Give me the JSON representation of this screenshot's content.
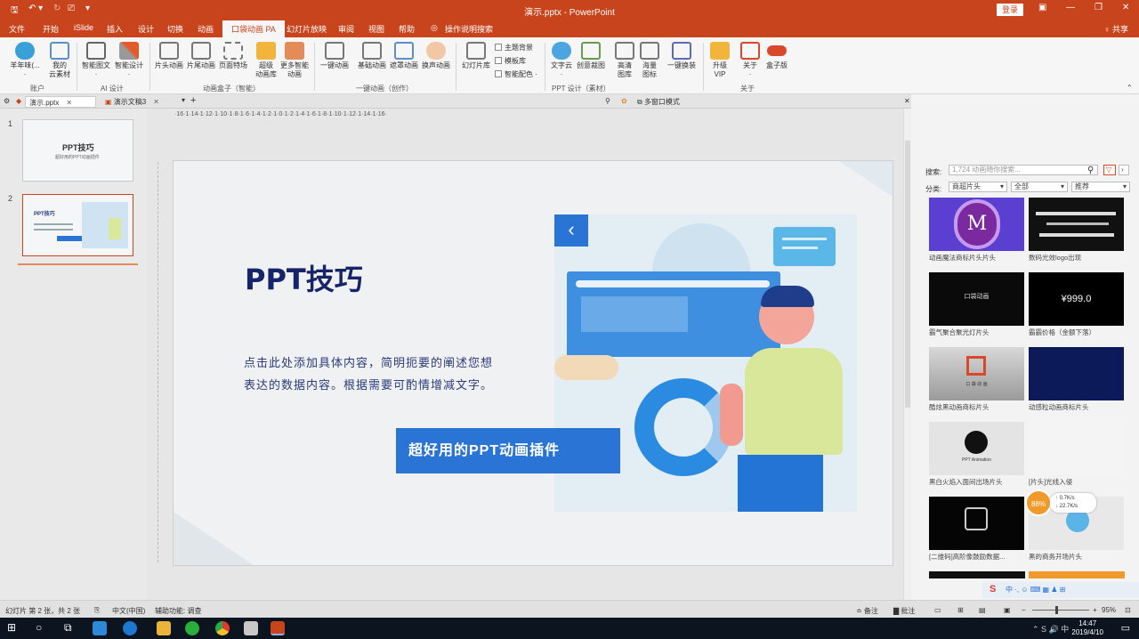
{
  "window": {
    "title": "演示.pptx  -  PowerPoint",
    "login": "登录",
    "share": "♀ 共享"
  },
  "menu": [
    "文件",
    "开始",
    "iSlide",
    "插入",
    "设计",
    "切换",
    "动画",
    "口袋动画 PA",
    "幻灯片放映",
    "审阅",
    "视图",
    "帮助",
    "操作说明搜索"
  ],
  "ribbon": {
    "buttons": [
      {
        "label": "羊年味(...",
        "sub": "·"
      },
      {
        "label": "我的",
        "sub": "云素材"
      },
      {
        "label": "智能图文",
        "sub": "·"
      },
      {
        "label": "智能设计",
        "sub": "·"
      },
      {
        "label": "片头动画",
        "sub": ""
      },
      {
        "label": "片尾动画",
        "sub": ""
      },
      {
        "label": "页面特场",
        "sub": ""
      },
      {
        "label": "超级",
        "sub": "动画库"
      },
      {
        "label": "更多智能",
        "sub": "动画"
      },
      {
        "label": "一键动画",
        "sub": ""
      },
      {
        "label": "基础动画",
        "sub": ""
      },
      {
        "label": "遮罩动画",
        "sub": ""
      },
      {
        "label": "换声动画",
        "sub": ""
      },
      {
        "label": "幻灯片库",
        "sub": ""
      },
      {
        "label": "文字云",
        "sub": "·"
      },
      {
        "label": "创意裁图",
        "sub": ""
      },
      {
        "label": "高清",
        "sub": "图库"
      },
      {
        "label": "海量",
        "sub": "图标"
      },
      {
        "label": "一键换装",
        "sub": ""
      },
      {
        "label": "升级",
        "sub": "VIP"
      },
      {
        "label": "关于",
        "sub": "·"
      },
      {
        "label": "盒子版",
        "sub": ""
      }
    ],
    "small": [
      "主题背景",
      "模板库",
      "智能配色 ·"
    ],
    "groups": [
      "账户",
      "AI 设计",
      "动画盒子（智能）",
      "一键动画（创作）",
      "PPT 设计（素材）",
      "关于"
    ]
  },
  "doc_tabs": [
    {
      "label": "演示.pptx"
    },
    {
      "label": "演示文稿3"
    }
  ],
  "doc_toolbar": {
    "multi_window": "多窗口模式"
  },
  "ruler": "·16·1·14·1·12·1·10·1·8·1·6·1·4·1·2·1·0·1·2·1·4·1·6·1·8·1·10·1·12·1·14·1·16·",
  "thumbnails": [
    {
      "num": "1",
      "title": "PPT技巧",
      "sub": "超好用的PPT动画插件"
    },
    {
      "num": "2",
      "title": "PPT技巧",
      "sub": ""
    }
  ],
  "slide": {
    "title": "PPT技巧",
    "body": "点击此处添加具体内容，简明扼要的阐述您想表达的数据内容。根据需要可酌情增减文字。",
    "button": "超好用的PPT动画插件",
    "back_arrow": "‹"
  },
  "panel": {
    "search_label": "搜索:",
    "search_placeholder": "1,724 动画随你搜索...",
    "category_label": "分类:",
    "dropdowns": [
      "商超片头",
      "全部",
      "推荐"
    ],
    "items": [
      {
        "caption": "动画魔法商标片头片头"
      },
      {
        "caption": "数码光效logo出现"
      },
      {
        "caption": "霸气聚合聚光灯片头"
      },
      {
        "caption": "霸霸价格（金额下落）"
      },
      {
        "caption": "酷炫黑动画商标片头"
      },
      {
        "caption": "动感粒动画商标片头"
      },
      {
        "caption": "黑白火焰入面间出场片头"
      },
      {
        "caption": "[片头]光线入侵"
      },
      {
        "caption": "[二维码]高阶像鼓励数据..."
      },
      {
        "caption": "黑的商务开场片头"
      }
    ],
    "card_texts": [
      "M",
      "口袋动画",
      "¥999.0",
      "PPT Animation",
      "口 袋 动 画"
    ],
    "speed": {
      "percent": "88%",
      "up": "0.7K/s",
      "down": "22.7K/s"
    }
  },
  "status": {
    "slide": "幻灯片 第 2 张，共 2 张",
    "lang": "中文(中国)",
    "accessibility": "辅助功能: 调查",
    "notes": "≐ 备注",
    "comments": "▇ 批注",
    "zoom": "95%"
  },
  "taskbar": {
    "time": "14:47",
    "date": "2019/4/10"
  }
}
